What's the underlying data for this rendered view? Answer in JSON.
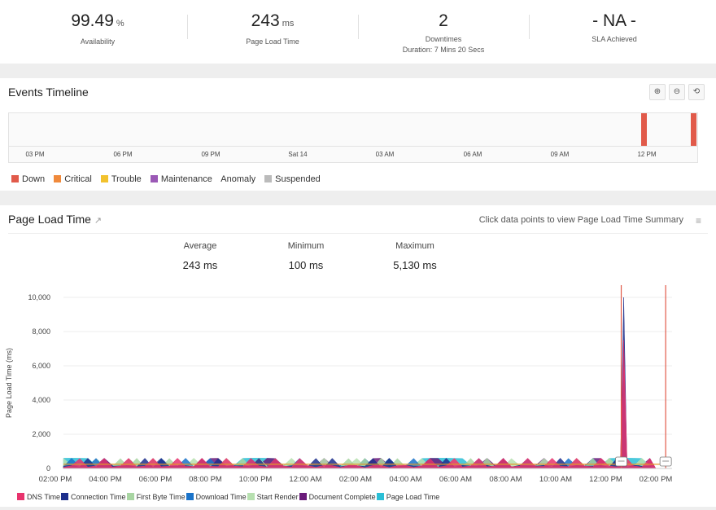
{
  "stats": [
    {
      "value": "99.49",
      "unit": "%",
      "label": "Availability",
      "sub": ""
    },
    {
      "value": "243",
      "unit": "ms",
      "label": "Page Load Time",
      "sub": ""
    },
    {
      "value": "2",
      "unit": "",
      "label": "Downtimes",
      "sub": "Duration: 7 Mins 20 Secs"
    },
    {
      "value": "- NA -",
      "unit": "",
      "label": "SLA Achieved",
      "sub": ""
    }
  ],
  "events": {
    "title": "Events Timeline",
    "ticks": [
      "03 PM",
      "06 PM",
      "09 PM",
      "Sat 14",
      "03 AM",
      "06 AM",
      "09 AM",
      "12 PM"
    ],
    "legend": [
      {
        "label": "Down",
        "color": "#e15a4a"
      },
      {
        "label": "Critical",
        "color": "#f08a3c"
      },
      {
        "label": "Trouble",
        "color": "#f2c22e"
      },
      {
        "label": "Maintenance",
        "color": "#9b59b6"
      },
      {
        "label": "Anomaly",
        "color": ""
      },
      {
        "label": "Suspended",
        "color": "#bbbbbb"
      }
    ],
    "zoom": {
      "zoom_in": "⊕",
      "zoom_out": "⊖",
      "reset": "⟲"
    }
  },
  "page_load": {
    "title": "Page Load Time",
    "hint": "Click data points to view Page Load Time Summary",
    "menu_icon": "≡",
    "external_icon": "↗",
    "summary": [
      {
        "label": "Average",
        "value": "243 ms"
      },
      {
        "label": "Minimum",
        "value": "100 ms"
      },
      {
        "label": "Maximum",
        "value": "5,130 ms"
      }
    ]
  },
  "chart_data": {
    "type": "area",
    "ylabel": "Page Load Time (ms)",
    "ylim": [
      0,
      10000
    ],
    "yticks": [
      "0",
      "2,000",
      "4,000",
      "6,000",
      "8,000",
      "10,000"
    ],
    "x": [
      "02:00 PM",
      "04:00 PM",
      "06:00 PM",
      "08:00 PM",
      "10:00 PM",
      "12:00 AM",
      "02:00 AM",
      "04:00 AM",
      "06:00 AM",
      "08:00 AM",
      "10:00 AM",
      "12:00 PM",
      "02:00 PM"
    ],
    "average_line": 243,
    "downtime_markers_hours": [
      22.6,
      24.4
    ],
    "spike_hour": 22.7,
    "series": [
      {
        "name": "DNS Time",
        "color": "#e8336d",
        "peak": 7500
      },
      {
        "name": "Connection Time",
        "color": "#1d2f8c",
        "peak": 10000
      },
      {
        "name": "First Byte Time",
        "color": "#a8d5a2",
        "peak": 300
      },
      {
        "name": "Download Time",
        "color": "#1a73c9",
        "peak": 300
      },
      {
        "name": "Start Render",
        "color": "#b7e0b0",
        "peak": 300
      },
      {
        "name": "Document Complete",
        "color": "#6a1b7a",
        "peak": 300
      },
      {
        "name": "Page Load Time",
        "color": "#2bbfd6",
        "peak": 5130
      }
    ]
  }
}
